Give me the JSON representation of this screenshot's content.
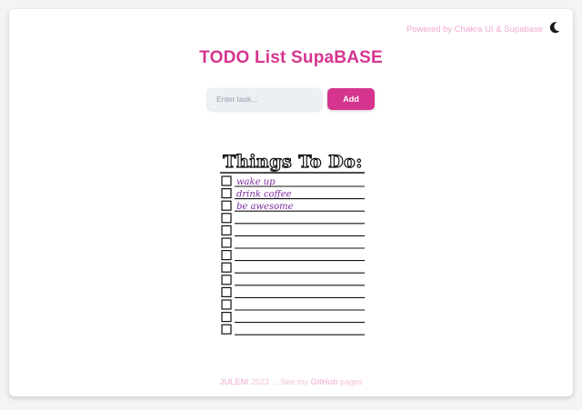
{
  "header": {
    "powered_by": "Powered by Chakra UI & Supabase",
    "theme_toggle_icon": "moon-icon"
  },
  "title": "TODO List SupaBASE",
  "task_input": {
    "placeholder": "Enter task...",
    "value": ""
  },
  "add_button_label": "Add",
  "todo_list": {
    "heading": "Things To Do:",
    "items": [
      "wake up",
      "drink coffee",
      "be awesome"
    ],
    "empty_rows": 10
  },
  "footer": {
    "author": "JULENI",
    "year_text": "2023 ... See my",
    "link": "GitHub",
    "suffix": "pages"
  },
  "colors": {
    "accent": "#d6358f",
    "muted_accent": "#f0a9cf",
    "handwriting": "#7a2a9e"
  }
}
